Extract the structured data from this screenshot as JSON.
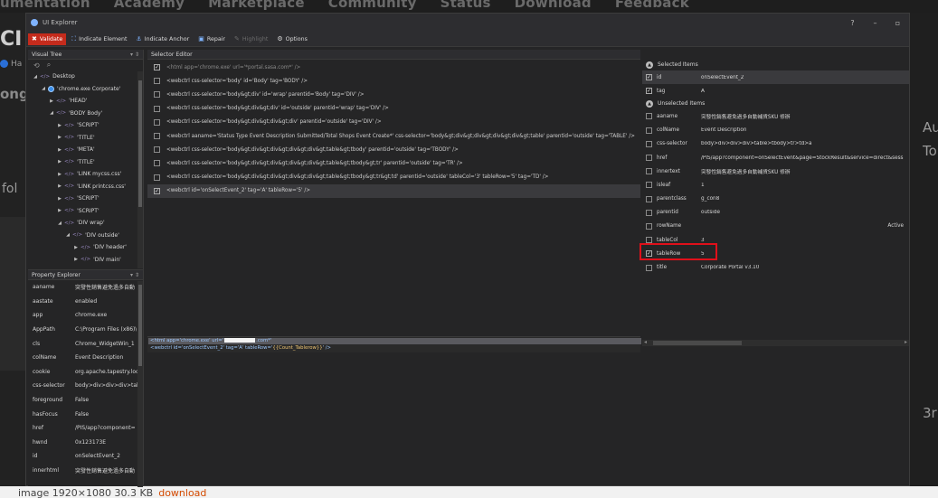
{
  "background": {
    "nav_items": [
      "umentation",
      "Academy",
      "Marketplace",
      "Community",
      "Status",
      "Download",
      "Feedback"
    ],
    "left_heading": "CI",
    "left_link": "Ha",
    "left_sub": "ong",
    "left_text": "fol",
    "right_text_1": "Au",
    "right_text_2": "To",
    "right_text_3": "3r",
    "bottom_text": "image 1920×1080 30.3 KB",
    "bottom_link": "download"
  },
  "window": {
    "title": "UI Explorer",
    "help": "?",
    "minimize": "–",
    "maximize": "▫"
  },
  "toolbar": {
    "validate": "Validate",
    "indicate_element": "Indicate Element",
    "indicate_anchor": "Indicate Anchor",
    "repair": "Repair",
    "highlight": "Highlight",
    "options": "Options"
  },
  "visual_tree": {
    "title": "Visual Tree",
    "pin": "▾ ⇕",
    "nodes": [
      {
        "label": "Desktop",
        "arrow": "◢",
        "icon": "tag",
        "indent": 0
      },
      {
        "label": "'chrome.exe Corporate'",
        "arrow": "◢",
        "icon": "chrome",
        "indent": 1
      },
      {
        "label": "'HEAD'",
        "arrow": "▶",
        "icon": "tag",
        "indent": 2
      },
      {
        "label": "'BODY Body'",
        "arrow": "◢",
        "icon": "tag",
        "indent": 2
      },
      {
        "label": "'SCRIPT'",
        "arrow": "▶",
        "icon": "tag",
        "indent": 3
      },
      {
        "label": "'TITLE'",
        "arrow": "▶",
        "icon": "tag",
        "indent": 3
      },
      {
        "label": "'META'",
        "arrow": "▶",
        "icon": "tag",
        "indent": 3
      },
      {
        "label": "'TITLE'",
        "arrow": "▶",
        "icon": "tag",
        "indent": 3
      },
      {
        "label": "'LINK mycss.css'",
        "arrow": "▶",
        "icon": "tag",
        "indent": 3
      },
      {
        "label": "'LINK printcss.css'",
        "arrow": "▶",
        "icon": "tag",
        "indent": 3
      },
      {
        "label": "'SCRIPT'",
        "arrow": "▶",
        "icon": "tag",
        "indent": 3
      },
      {
        "label": "'SCRIPT'",
        "arrow": "▶",
        "icon": "tag",
        "indent": 3
      },
      {
        "label": "'DIV wrap'",
        "arrow": "◢",
        "icon": "tag",
        "indent": 3
      },
      {
        "label": "'DIV outside'",
        "arrow": "◢",
        "icon": "tag",
        "indent": 4
      },
      {
        "label": "'DIV header'",
        "arrow": "▶",
        "icon": "tag",
        "indent": 5
      },
      {
        "label": "'DIV main'",
        "arrow": "▶",
        "icon": "tag",
        "indent": 5
      }
    ]
  },
  "property_explorer": {
    "title": "Property Explorer",
    "pin": "▾ ⇕",
    "rows": [
      {
        "key": "aaname",
        "value": "突發性銷售避免過多自動"
      },
      {
        "key": "aastate",
        "value": "enabled"
      },
      {
        "key": "app",
        "value": "chrome.exe"
      },
      {
        "key": "AppPath",
        "value": "C:\\Program Files (x86)\\"
      },
      {
        "key": "cls",
        "value": "Chrome_WidgetWin_1"
      },
      {
        "key": "colName",
        "value": "Event Description"
      },
      {
        "key": "cookie",
        "value": "org.apache.tapestry.loc"
      },
      {
        "key": "css-selector",
        "value": "body>div>div>div>tal"
      },
      {
        "key": "foreground",
        "value": "False"
      },
      {
        "key": "hasFocus",
        "value": "False"
      },
      {
        "key": "href",
        "value": "/PIS/app?component="
      },
      {
        "key": "hwnd",
        "value": "0x123173E"
      },
      {
        "key": "id",
        "value": "onSelectEvent_2"
      },
      {
        "key": "innerhtml",
        "value": "突發性銷售避免過多自動"
      }
    ]
  },
  "selector_editor": {
    "title": "Selector Editor",
    "rows": [
      {
        "checked": true,
        "text": "<html app='chrome.exe' url='*portal.sasa.com*' />"
      },
      {
        "checked": false,
        "text": "<webctrl css-selector='body' id='Body' tag='BODY' />"
      },
      {
        "checked": false,
        "text": "<webctrl css-selector='body&gt;div' id='wrap' parentid='Body' tag='DIV' />"
      },
      {
        "checked": false,
        "text": "<webctrl css-selector='body&gt;div&gt;div' id='outside' parentid='wrap' tag='DIV' />"
      },
      {
        "checked": false,
        "text": "<webctrl css-selector='body&gt;div&gt;div&gt;div' parentid='outside' tag='DIV' />"
      },
      {
        "checked": false,
        "text": "<webctrl aaname='Status Type Event Description Submitted/Total Shops Event Create*' css-selector='body&gt;div&gt;div&gt;div&gt;div&gt;table' parentid='outside' tag='TABLE' />"
      },
      {
        "checked": false,
        "text": "<webctrl css-selector='body&gt;div&gt;div&gt;div&gt;div&gt;table&gt;tbody' parentid='outside' tag='TBODY' />"
      },
      {
        "checked": false,
        "text": "<webctrl css-selector='body&gt;div&gt;div&gt;div&gt;div&gt;table&gt;tbody&gt;tr' parentid='outside' tag='TR' />"
      },
      {
        "checked": false,
        "text": "<webctrl css-selector='body&gt;div&gt;div&gt;div&gt;div&gt;table&gt;tbody&gt;tr&gt;td' parentid='outside' tableCol='3' tableRow='5' tag='TD' />"
      },
      {
        "checked": true,
        "text": "<webctrl id='onSelectEvent_2' tag='A' tableRow='5' />"
      }
    ],
    "preview_line1_a": "<html app='chrome.exe' url='",
    "preview_line1_b": ".com*'",
    "preview_line2_a": "<webctrl id='onSelectEvent_2' tag='A' tableRow='",
    "preview_line2_var": "{{Count_Tablerow}}",
    "preview_line2_b": "' />"
  },
  "selected_items": {
    "selected_title": "Selected Items",
    "unselected_title": "Unselected Items",
    "selected": [
      {
        "checked": true,
        "key": "id",
        "value": "onSelectEvent_2",
        "highlighted": true
      },
      {
        "checked": true,
        "key": "tag",
        "value": "A"
      }
    ],
    "unselected": [
      {
        "checked": false,
        "key": "aaname",
        "value": "突發性銷售避免過多自動補貨SKU 修辦"
      },
      {
        "checked": false,
        "key": "colName",
        "value": "Event Description"
      },
      {
        "checked": false,
        "key": "css-selector",
        "value": "body>div>div>div>table>tbody>tr>td>a"
      },
      {
        "checked": false,
        "key": "href",
        "value": "/PIS/app?component=onSelectEvent&page=StockResult&service=direct&sess"
      },
      {
        "checked": false,
        "key": "innertext",
        "value": "突發性銷售避免過多自動補貨SKU 修辦"
      },
      {
        "checked": false,
        "key": "isleaf",
        "value": "1"
      },
      {
        "checked": false,
        "key": "parentclass",
        "value": "g_con8"
      },
      {
        "checked": false,
        "key": "parentid",
        "value": "outside"
      },
      {
        "checked": false,
        "key": "rowName",
        "value": "",
        "extra": "Active"
      },
      {
        "checked": false,
        "key": "tableCol",
        "value": "3"
      },
      {
        "checked": true,
        "key": "tableRow",
        "value": "5"
      },
      {
        "checked": false,
        "key": "title",
        "value": "Corporate Portal v3.10"
      }
    ],
    "scroll_left": "◂",
    "scroll_right": "▸"
  },
  "colors": {
    "validate_bg": "#c42b1c",
    "highlight_box": "#e0101a",
    "window_bg": "#252526"
  }
}
